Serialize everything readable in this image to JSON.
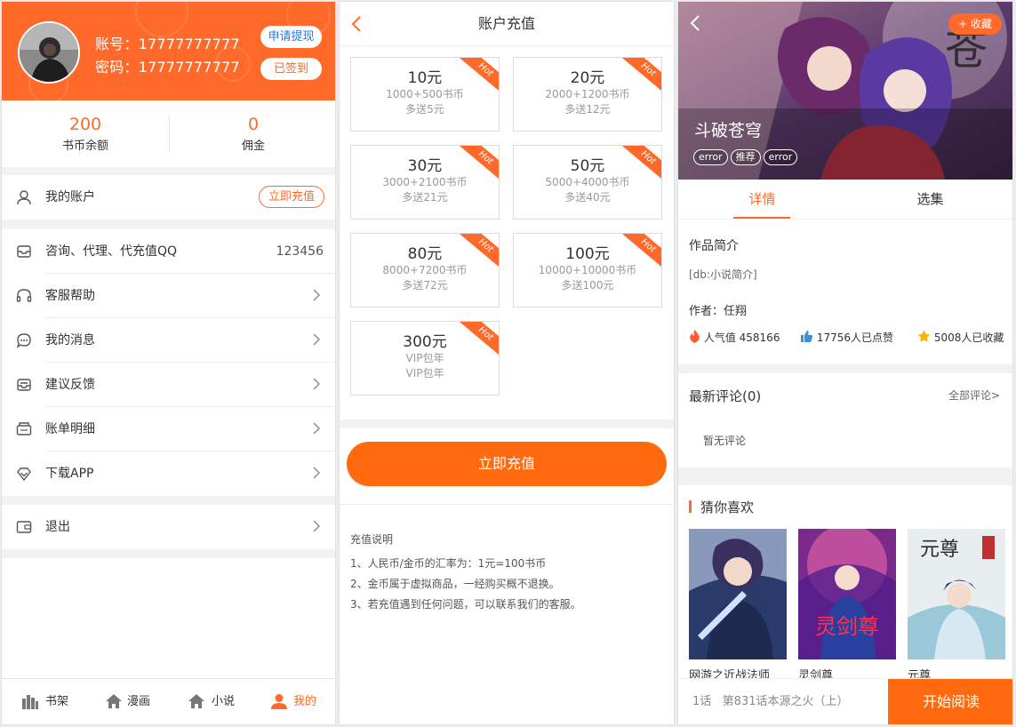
{
  "account": {
    "account_line": "账号：17777777777",
    "password_line": "密码：17777777777",
    "withdraw_label": "申请提现",
    "signed_label": "已签到",
    "coin_balance": "200",
    "coin_balance_label": "书币余额",
    "commission": "0",
    "commission_label": "佣金",
    "my_account_label": "我的账户",
    "recharge_now_label": "立即充值",
    "menu": [
      {
        "label": "咨询、代理、代充值QQ",
        "value": "123456",
        "icon": "envelope-icon"
      },
      {
        "label": "客服帮助",
        "icon": "headset-icon"
      },
      {
        "label": "我的消息",
        "icon": "chat-bubble-icon"
      },
      {
        "label": "建议反馈",
        "icon": "feedback-icon"
      },
      {
        "label": "账单明细",
        "icon": "bill-icon"
      },
      {
        "label": "下载APP",
        "icon": "diamond-icon"
      }
    ],
    "logout_label": "退出",
    "nav": [
      {
        "label": "书架",
        "icon": "bookshelf-icon"
      },
      {
        "label": "漫画",
        "icon": "home-icon"
      },
      {
        "label": "小说",
        "icon": "home-icon"
      },
      {
        "label": "我的",
        "icon": "user-icon",
        "active": true
      }
    ]
  },
  "recharge": {
    "title": "账户充值",
    "hot_label": "Hot",
    "options": [
      {
        "price": "10元",
        "coins": "1000+500书币",
        "bonus": "多送5元"
      },
      {
        "price": "20元",
        "coins": "2000+1200书币",
        "bonus": "多送12元"
      },
      {
        "price": "30元",
        "coins": "3000+2100书币",
        "bonus": "多送21元"
      },
      {
        "price": "50元",
        "coins": "5000+4000书币",
        "bonus": "多送40元"
      },
      {
        "price": "80元",
        "coins": "8000+7200书币",
        "bonus": "多送72元"
      },
      {
        "price": "100元",
        "coins": "10000+10000书币",
        "bonus": "多送100元"
      },
      {
        "price": "300元",
        "coins": "VIP包年",
        "bonus": "VIP包年"
      }
    ],
    "button_label": "立即充值",
    "notes_title": "充值说明",
    "notes": [
      "1、人民币/金币的汇率为：1元=100书币",
      "2、金币属于虚拟商品，一经购买概不退换。",
      "3、若充值遇到任何问题，可以联系我们的客服。"
    ]
  },
  "detail": {
    "collect_label": "+ 收藏",
    "book_title": "斗破苍穹",
    "tags": [
      "error",
      "推荐",
      "error"
    ],
    "tab_detail": "详情",
    "tab_episodes": "选集",
    "intro_title": "作品简介",
    "intro_text": "[db:小说简介]",
    "author_line": "作者：任翔",
    "popularity": "人气值 458166",
    "likes": "17756人已点赞",
    "favorites": "5008人已收藏",
    "comments_title": "最新评论(0)",
    "all_comments": "全部评论>",
    "no_comments": "暂无评论",
    "guess_title": "猜你喜欢",
    "recommendations": [
      "网游之近战法师",
      "灵剑尊",
      "元尊"
    ],
    "cover_caption_2": "灵剑尊",
    "cover_caption_3": "元尊",
    "chapter_info": "1话   第831话本源之火（上）",
    "start_read_label": "开始阅读",
    "colors": {
      "accent": "#ff6a2a",
      "button": "#ff6a0e"
    }
  }
}
